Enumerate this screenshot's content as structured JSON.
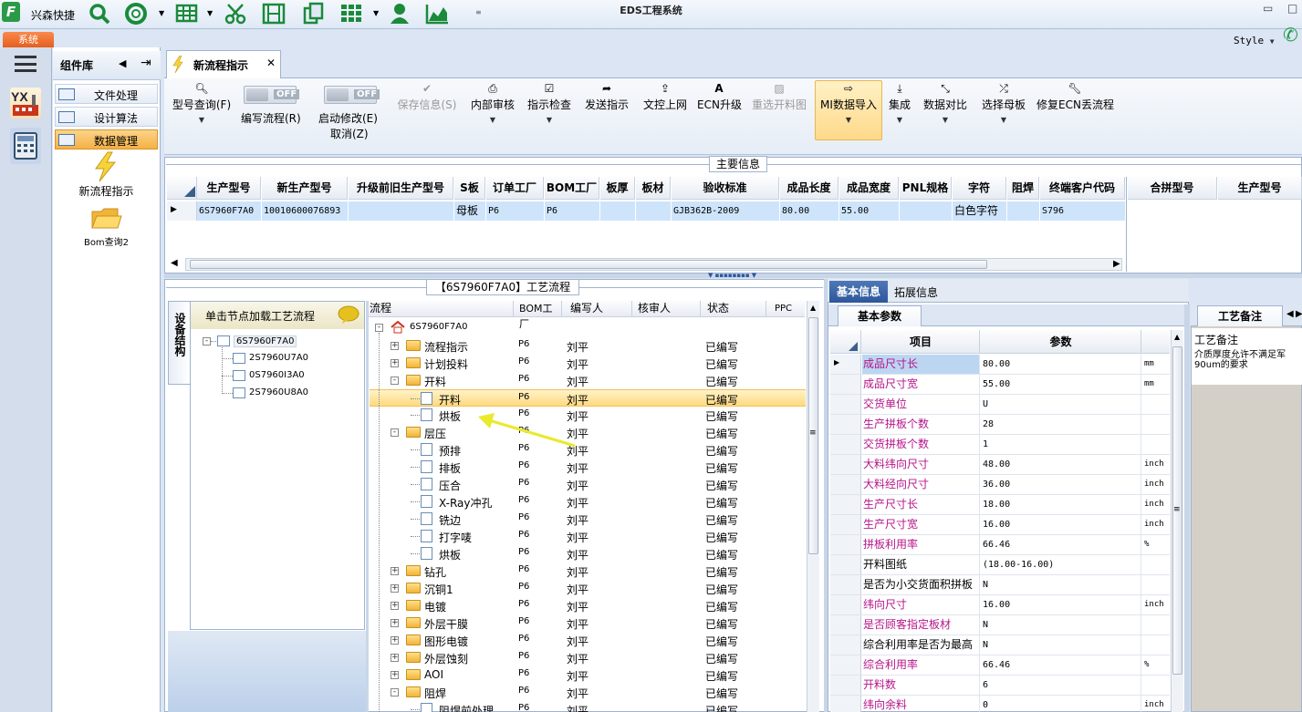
{
  "title_bar": {
    "app_title": "EDS工程系统",
    "quick_access_label": "兴森快捷",
    "quick_icons": [
      "search-icon",
      "lifebuoy-icon",
      "table-icon",
      "scissors-icon",
      "film-icon",
      "copy-icon",
      "grid-icon",
      "user-icon",
      "chart-icon"
    ],
    "system_tab": "系统",
    "style_label": "Style"
  },
  "left_nav": {
    "icons": [
      "menu-icon",
      "yx-factory-icon",
      "calculator-icon"
    ]
  },
  "component_library": {
    "title": "组件库",
    "items": [
      {
        "label": "文件处理"
      },
      {
        "label": "设计算法"
      },
      {
        "label": "数据管理",
        "active": true
      }
    ],
    "shortcuts": [
      {
        "label": "新流程指示",
        "icon": "lightning-icon"
      },
      {
        "label": "Bom查询2",
        "icon": "folder-icon"
      }
    ]
  },
  "document_tab": {
    "label": "新流程指示"
  },
  "toolbar": {
    "buttons": [
      {
        "label": "型号查询(F)",
        "icon": "search-icon"
      },
      {
        "label": "编写流程(R)",
        "toggle": "OFF"
      },
      {
        "label": "启动修改(E)",
        "label2": "取消(Z)",
        "toggle": "OFF"
      },
      {
        "label": "保存信息(S)",
        "icon": "check-icon",
        "disabled": true
      },
      {
        "label": "内部审核",
        "icon": "print-icon"
      },
      {
        "label": "指示检查",
        "icon": "checkbox-icon"
      },
      {
        "label": "发送指示",
        "icon": "send-icon"
      },
      {
        "label": "文控上网",
        "icon": "upload-icon"
      },
      {
        "label": "ECN升级",
        "icon": "upgrade-icon"
      },
      {
        "label": "重选开料图",
        "icon": "image-icon",
        "disabled": true
      },
      {
        "label": "MI数据导入",
        "icon": "import-icon",
        "highlighted": true
      },
      {
        "label": "集成",
        "icon": "download-icon"
      },
      {
        "label": "数据对比",
        "icon": "compare-icon"
      },
      {
        "label": "选择母板",
        "icon": "shuffle-icon"
      },
      {
        "label": "修复ECN丢流程",
        "icon": "wrench-icon"
      }
    ]
  },
  "main_info": {
    "title": "主要信息",
    "columns": [
      "生产型号",
      "新生产型号",
      "升级前旧生产型号",
      "S板",
      "订单工厂",
      "BOM工厂",
      "板厚",
      "板材",
      "验收标准",
      "成品长度",
      "成品宽度",
      "PNL规格",
      "字符",
      "阻焊",
      "终端客户代码"
    ],
    "rows": [
      [
        "6S7960F7A0",
        "10010600076893",
        "",
        "母板",
        "P6",
        "P6",
        "",
        "",
        "GJB362B-2009",
        "80.00",
        "55.00",
        "",
        "白色字符",
        "",
        "S796"
      ]
    ],
    "right_columns": [
      "合拼型号",
      "生产型号"
    ]
  },
  "flow": {
    "title": "【6S7960F7A0】工艺流程",
    "device_tab": "设备结构",
    "device_header": "单击节点加载工艺流程",
    "device_tree": {
      "root": "6S7960F7A0",
      "children": [
        "2S7960U7A0",
        "0S7960I3A0",
        "2S7960U8A0"
      ]
    },
    "columns": [
      "流程",
      "BOM工厂",
      "编写人",
      "核审人",
      "状态",
      "PPC"
    ],
    "root": "6S7960F7A0",
    "rows": [
      {
        "name": "流程指示",
        "level": 1,
        "type": "folder",
        "expander": "+",
        "bom": "P6",
        "writer": "刘平",
        "status": "已编写"
      },
      {
        "name": "计划投料",
        "level": 1,
        "type": "folder",
        "expander": "+",
        "bom": "P6",
        "writer": "刘平",
        "status": "已编写"
      },
      {
        "name": "开料",
        "level": 1,
        "type": "folder",
        "expander": "-",
        "bom": "P6",
        "writer": "刘平",
        "status": "已编写"
      },
      {
        "name": "开料",
        "level": 2,
        "type": "doc",
        "bom": "P6",
        "writer": "刘平",
        "status": "已编写",
        "selected": true
      },
      {
        "name": "烘板",
        "level": 2,
        "type": "doc",
        "bom": "P6",
        "writer": "刘平",
        "status": "已编写"
      },
      {
        "name": "层压",
        "level": 1,
        "type": "folder",
        "expander": "-",
        "bom": "P6",
        "writer": "刘平",
        "status": "已编写"
      },
      {
        "name": "预排",
        "level": 2,
        "type": "doc",
        "bom": "P6",
        "writer": "刘平",
        "status": "已编写"
      },
      {
        "name": "排板",
        "level": 2,
        "type": "doc",
        "bom": "P6",
        "writer": "刘平",
        "status": "已编写"
      },
      {
        "name": "压合",
        "level": 2,
        "type": "doc",
        "bom": "P6",
        "writer": "刘平",
        "status": "已编写"
      },
      {
        "name": "X-Ray冲孔",
        "level": 2,
        "type": "doc",
        "bom": "P6",
        "writer": "刘平",
        "status": "已编写"
      },
      {
        "name": "铣边",
        "level": 2,
        "type": "doc",
        "bom": "P6",
        "writer": "刘平",
        "status": "已编写"
      },
      {
        "name": "打字唛",
        "level": 2,
        "type": "doc",
        "bom": "P6",
        "writer": "刘平",
        "status": "已编写"
      },
      {
        "name": "烘板",
        "level": 2,
        "type": "doc",
        "bom": "P6",
        "writer": "刘平",
        "status": "已编写"
      },
      {
        "name": "钻孔",
        "level": 1,
        "type": "folder",
        "expander": "+",
        "bom": "P6",
        "writer": "刘平",
        "status": "已编写"
      },
      {
        "name": "沉铜1",
        "level": 1,
        "type": "folder",
        "expander": "+",
        "bom": "P6",
        "writer": "刘平",
        "status": "已编写"
      },
      {
        "name": "电镀",
        "level": 1,
        "type": "folder",
        "expander": "+",
        "bom": "P6",
        "writer": "刘平",
        "status": "已编写"
      },
      {
        "name": "外层干膜",
        "level": 1,
        "type": "folder",
        "expander": "+",
        "bom": "P6",
        "writer": "刘平",
        "status": "已编写"
      },
      {
        "name": "图形电镀",
        "level": 1,
        "type": "folder",
        "expander": "+",
        "bom": "P6",
        "writer": "刘平",
        "status": "已编写"
      },
      {
        "name": "外层蚀刻",
        "level": 1,
        "type": "folder",
        "expander": "+",
        "bom": "P6",
        "writer": "刘平",
        "status": "已编写"
      },
      {
        "name": "AOI",
        "level": 1,
        "type": "folder",
        "expander": "+",
        "bom": "P6",
        "writer": "刘平",
        "status": "已编写"
      },
      {
        "name": "阻焊",
        "level": 1,
        "type": "folder",
        "expander": "-",
        "bom": "P6",
        "writer": "刘平",
        "status": "已编写"
      },
      {
        "name": "阻焊前处理",
        "level": 2,
        "type": "doc",
        "bom": "P6",
        "writer": "刘平",
        "status": "已编写"
      }
    ]
  },
  "properties": {
    "tabs": [
      "基本信息",
      "拓展信息"
    ],
    "subtab": "基本参数",
    "columns": [
      "项目",
      "参数"
    ],
    "rows": [
      {
        "key": "成品尺寸长",
        "value": "80.00",
        "unit": "mm",
        "magenta": true,
        "selected": true
      },
      {
        "key": "成品尺寸宽",
        "value": "55.00",
        "unit": "mm",
        "magenta": true
      },
      {
        "key": "交货单位",
        "value": "U",
        "unit": "",
        "magenta": true
      },
      {
        "key": "生产拼板个数",
        "value": "28",
        "unit": "",
        "magenta": true
      },
      {
        "key": "交货拼板个数",
        "value": "1",
        "unit": "",
        "magenta": true
      },
      {
        "key": "大料纬向尺寸",
        "value": "48.00",
        "unit": "inch",
        "magenta": true
      },
      {
        "key": "大料经向尺寸",
        "value": "36.00",
        "unit": "inch",
        "magenta": true
      },
      {
        "key": "生产尺寸长",
        "value": "18.00",
        "unit": "inch",
        "magenta": true
      },
      {
        "key": "生产尺寸宽",
        "value": "16.00",
        "unit": "inch",
        "magenta": true
      },
      {
        "key": "拼板利用率",
        "value": "66.46",
        "unit": "%",
        "magenta": true
      },
      {
        "key": "开料图纸",
        "value": "(18.00-16.00)",
        "unit": "",
        "magenta": false
      },
      {
        "key": "是否为小交货面积拼板",
        "value": "N",
        "unit": "",
        "magenta": false
      },
      {
        "key": "纬向尺寸",
        "value": "16.00",
        "unit": "inch",
        "magenta": true
      },
      {
        "key": "是否顾客指定板材",
        "value": "N",
        "unit": "",
        "magenta": true
      },
      {
        "key": "综合利用率是否为最高",
        "value": "N",
        "unit": "",
        "magenta": false
      },
      {
        "key": "综合利用率",
        "value": "66.46",
        "unit": "%",
        "magenta": true
      },
      {
        "key": "开料数",
        "value": "6",
        "unit": "",
        "magenta": true
      },
      {
        "key": "纬向余料",
        "value": "0",
        "unit": "inch",
        "magenta": true
      }
    ]
  },
  "remark": {
    "tab": "工艺备注",
    "label": "工艺备注",
    "text_line1": "介质厚度允许不满足军",
    "text_line2": "90um的要求"
  },
  "colors": {
    "accent": "#2d579b",
    "highlight": "#ffd980",
    "magenta": "#b5148a",
    "arrow": "#e9ea2c"
  }
}
